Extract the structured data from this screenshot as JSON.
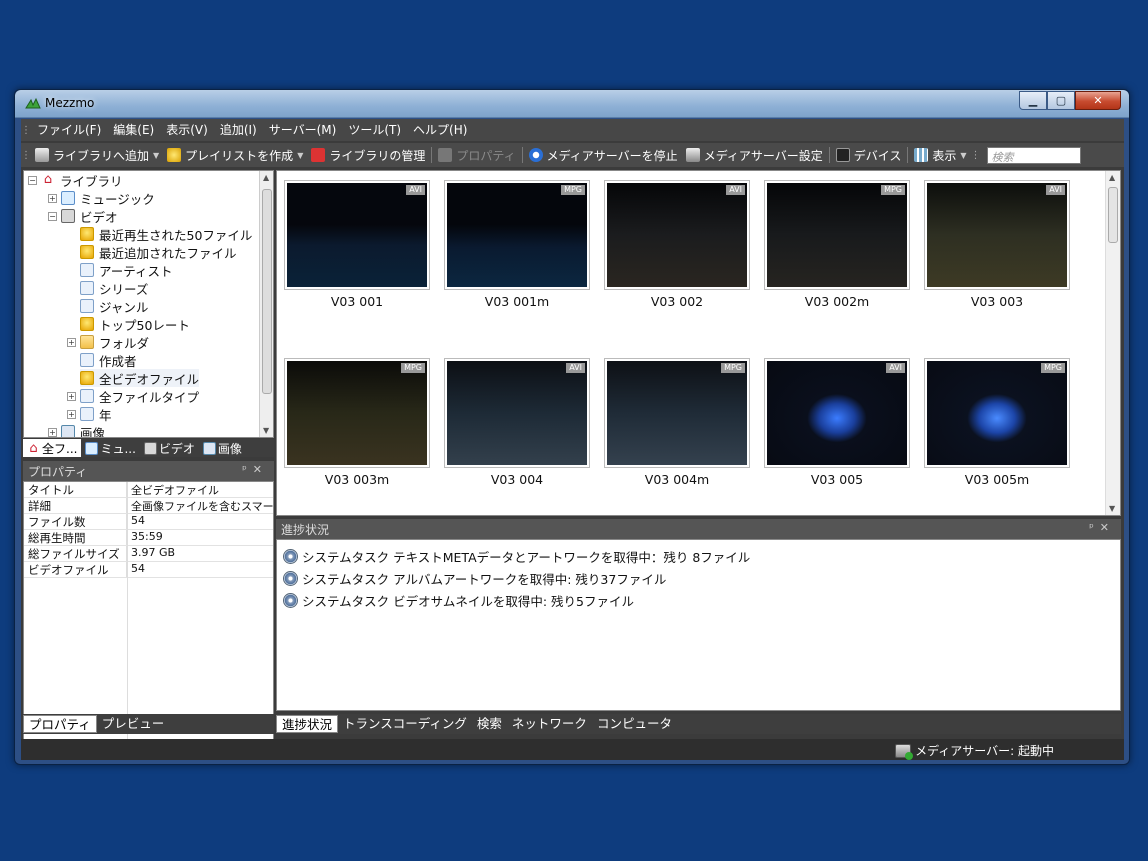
{
  "window": {
    "title": "Mezzmo"
  },
  "menu": [
    "ファイル(F)",
    "編集(E)",
    "表示(V)",
    "追加(I)",
    "サーバー(M)",
    "ツール(T)",
    "ヘルプ(H)"
  ],
  "toolbar": {
    "add_library": "ライブラリへ追加",
    "create_playlist": "プレイリストを作成",
    "manage_library": "ライブラリの管理",
    "properties": "プロパティ",
    "stop_server": "メディアサーバーを停止",
    "server_settings": "メディアサーバー設定",
    "devices": "デバイス",
    "view": "表示",
    "search_placeholder": "検索"
  },
  "tree": {
    "root": "ライブラリ",
    "music": "ミュージック",
    "video": "ビデオ",
    "items": [
      "最近再生された50ファイル",
      "最近追加されたファイル",
      "アーティスト",
      "シリーズ",
      "ジャンル",
      "トップ50レート",
      "フォルダ",
      "作成者",
      "全ビデオファイル",
      "全ファイルタイプ",
      "年"
    ],
    "image": "画像"
  },
  "left_tabs": [
    "全フ...",
    "ミュ...",
    "ビデオ",
    "画像"
  ],
  "properties": {
    "header": "プロパティ",
    "rows": [
      {
        "k": "タイトル",
        "v": "全ビデオファイル"
      },
      {
        "k": "詳細",
        "v": "全画像ファイルを含むスマー..."
      },
      {
        "k": "ファイル数",
        "v": "54"
      },
      {
        "k": "総再生時間",
        "v": "35:59"
      },
      {
        "k": "総ファイルサイズ",
        "v": "3.97 GB"
      },
      {
        "k": "ビデオファイル",
        "v": "54"
      }
    ]
  },
  "left_bottom_tabs": [
    "プロパティ",
    "プレビュー"
  ],
  "thumbnails": [
    {
      "label": "V03 001",
      "badge": "AVI"
    },
    {
      "label": "V03 001m",
      "badge": "MPG"
    },
    {
      "label": "V03 002",
      "badge": "AVI"
    },
    {
      "label": "V03 002m",
      "badge": "MPG"
    },
    {
      "label": "V03 003",
      "badge": "AVI"
    },
    {
      "label": "V03 003m",
      "badge": "MPG"
    },
    {
      "label": "V03 004",
      "badge": "AVI"
    },
    {
      "label": "V03 004m",
      "badge": "MPG"
    },
    {
      "label": "V03 005",
      "badge": "AVI"
    },
    {
      "label": "V03 005m",
      "badge": "MPG"
    }
  ],
  "progress": {
    "header": "進捗状況",
    "tasks": [
      "システムタスク  テキストMETAデータとアートワークを取得中：残り 8ファイル",
      "システムタスク  アルバムアートワークを取得中: 残り37ファイル",
      "システムタスク  ビデオサムネイルを取得中: 残り5ファイル"
    ]
  },
  "bottom_tabs": [
    "進捗状況",
    "トランスコーディング",
    "検索",
    "ネットワーク",
    "コンピュータ"
  ],
  "status": {
    "server": "メディアサーバー: 起動中"
  }
}
